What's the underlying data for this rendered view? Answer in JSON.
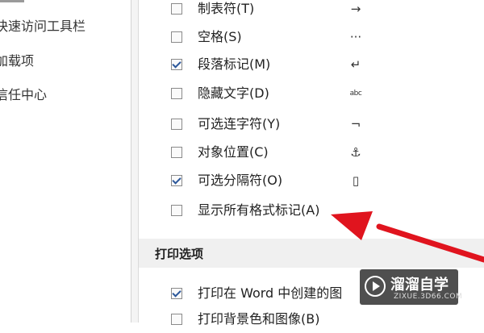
{
  "nav": {
    "items": [
      "快速访问工具栏",
      "加载项",
      "信任中心"
    ]
  },
  "display_marks": [
    {
      "label": "制表符(T)",
      "checked": false,
      "icon": "arrow-right-icon",
      "glyph": "→"
    },
    {
      "label": "空格(S)",
      "checked": false,
      "icon": "dots-icon",
      "glyph": "···"
    },
    {
      "label": "段落标记(M)",
      "checked": true,
      "icon": "paragraph-mark-icon",
      "glyph": "↵"
    },
    {
      "label": "隐藏文字(D)",
      "checked": false,
      "icon": "hidden-text-icon",
      "glyph": "abc"
    },
    {
      "label": "可选连字符(Y)",
      "checked": false,
      "icon": "optional-hyphen-icon",
      "glyph": "¬"
    },
    {
      "label": "对象位置(C)",
      "checked": false,
      "icon": "anchor-icon",
      "glyph": "⚓"
    },
    {
      "label": "可选分隔符(O)",
      "checked": true,
      "icon": "separator-icon",
      "glyph": "▯"
    },
    {
      "label": "显示所有格式标记(A)",
      "checked": false,
      "icon": "",
      "glyph": ""
    }
  ],
  "print_section": {
    "title": "打印选项",
    "items": [
      {
        "label": "打印在 Word 中创建的图",
        "checked": true
      },
      {
        "label": "打印背景色和图像(B)",
        "checked": false
      }
    ]
  },
  "watermark": {
    "name": "溜溜自学",
    "url": "ZIXUE.3D66.COM"
  },
  "colors": {
    "accent": "#2b579a",
    "arrow": "#e0141e"
  }
}
